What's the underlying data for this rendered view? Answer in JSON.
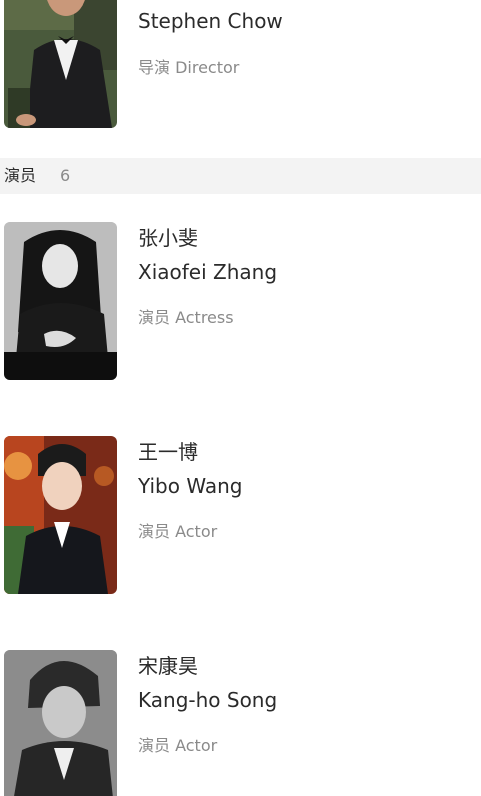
{
  "director": {
    "name_en": "Stephen Chow",
    "role": "导演 Director",
    "photo_icon": "portrait-photo"
  },
  "cast_section": {
    "title": "演员",
    "count": "6"
  },
  "cast": [
    {
      "name_cn": "张小斐",
      "name_en": "Xiaofei Zhang",
      "role": "演员 Actress"
    },
    {
      "name_cn": "王一博",
      "name_en": "Yibo Wang",
      "role": "演员 Actor"
    },
    {
      "name_cn": "宋康昊",
      "name_en": "Kang-ho Song",
      "role": "演员 Actor"
    }
  ]
}
